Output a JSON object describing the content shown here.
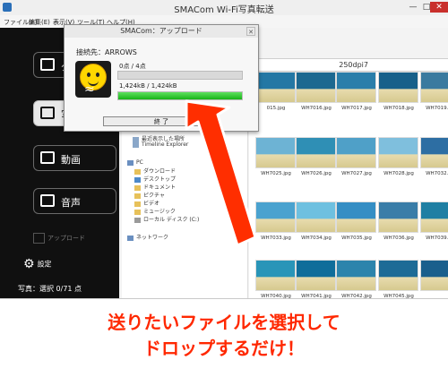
{
  "window": {
    "title": "SMACom Wi-Fi写真転送",
    "menu": [
      "ファイル(F)",
      "編集(E)",
      "表示(V)",
      "ツール(T)",
      "ヘルプ(H)"
    ]
  },
  "sidebar": {
    "items": [
      {
        "label": "ダウ",
        "icon": "download-icon"
      },
      {
        "label": "写",
        "icon": "camera-icon"
      },
      {
        "label": "動画",
        "icon": "video-icon"
      },
      {
        "label": "音声",
        "icon": "speaker-icon"
      }
    ],
    "upload_label": "アップロード",
    "settings_label": "設定",
    "photo_count": "写真：選択 0/71 点"
  },
  "address": {
    "current": "250dpi7"
  },
  "tree": [
    "最近表示した場所",
    "Timeline Explorer",
    "PC",
    "ダウンロード",
    "デスクトップ",
    "ドキュメント",
    "ピクチャ",
    "ビデオ",
    "ミュージック",
    "ローカル ディスク (C:)",
    "ネットワーク"
  ],
  "files": [
    {
      "name": "015.jpg",
      "color": "#6fa5c7"
    },
    {
      "name": "WH7016.jpg",
      "color": "#4e86b8"
    },
    {
      "name": "WH7017.jpg",
      "color": "#3b72a8"
    },
    {
      "name": "WH7018.jpg",
      "color": "#5a99cc"
    },
    {
      "name": "WH7019.jpg",
      "color": "#3a7a9f"
    },
    {
      "name": "WH7025.jpg",
      "color": "#6db3d4"
    },
    {
      "name": "WH7026.jpg",
      "color": "#2f8fb5"
    },
    {
      "name": "WH7027.jpg",
      "color": "#4fa0c8"
    },
    {
      "name": "WH7028.jpg",
      "color": "#7fbfdd"
    },
    {
      "name": "WH7032.jpg",
      "color": "#2d6ea3"
    },
    {
      "name": "WH7033.jpg",
      "color": "#4aa2cf"
    },
    {
      "name": "WH7034.jpg",
      "color": "#6ec0e0"
    },
    {
      "name": "WH7035.jpg",
      "color": "#358ec4"
    },
    {
      "name": "WH7036.jpg",
      "color": "#3a7da8"
    },
    {
      "name": "WH7039.jpg",
      "color": "#1f7fa3"
    },
    {
      "name": "WH7040.jpg",
      "color": "#2995b8"
    },
    {
      "name": "WH7041.jpg",
      "color": "#0f6d9a"
    },
    {
      "name": "WH7042.jpg",
      "color": "#2c84ac"
    },
    {
      "name": "WH7045.jpg",
      "color": "#1d6b96"
    },
    {
      "name": "",
      "color": "#1a5f8c"
    },
    {
      "name": "",
      "color": "#2477a4"
    },
    {
      "name": "",
      "color": "#1c6890"
    },
    {
      "name": "",
      "color": "#2a7eaa"
    },
    {
      "name": "",
      "color": "#17608a"
    }
  ],
  "dialog": {
    "title": "SMACom：アップロード",
    "destination": "接続先：ARROWS",
    "count_text": "0点 / 4点",
    "count_progress": 0,
    "size_text": "1,424kB / 1,424kB",
    "size_progress": 1,
    "end_button": "終 了"
  },
  "caption": {
    "line1": "送りたいファイルを選択して",
    "line2": "ドロップするだけ！"
  },
  "colors": {
    "accent": "#ff2800",
    "progress": "#2ec22e",
    "panel": "#101010"
  }
}
